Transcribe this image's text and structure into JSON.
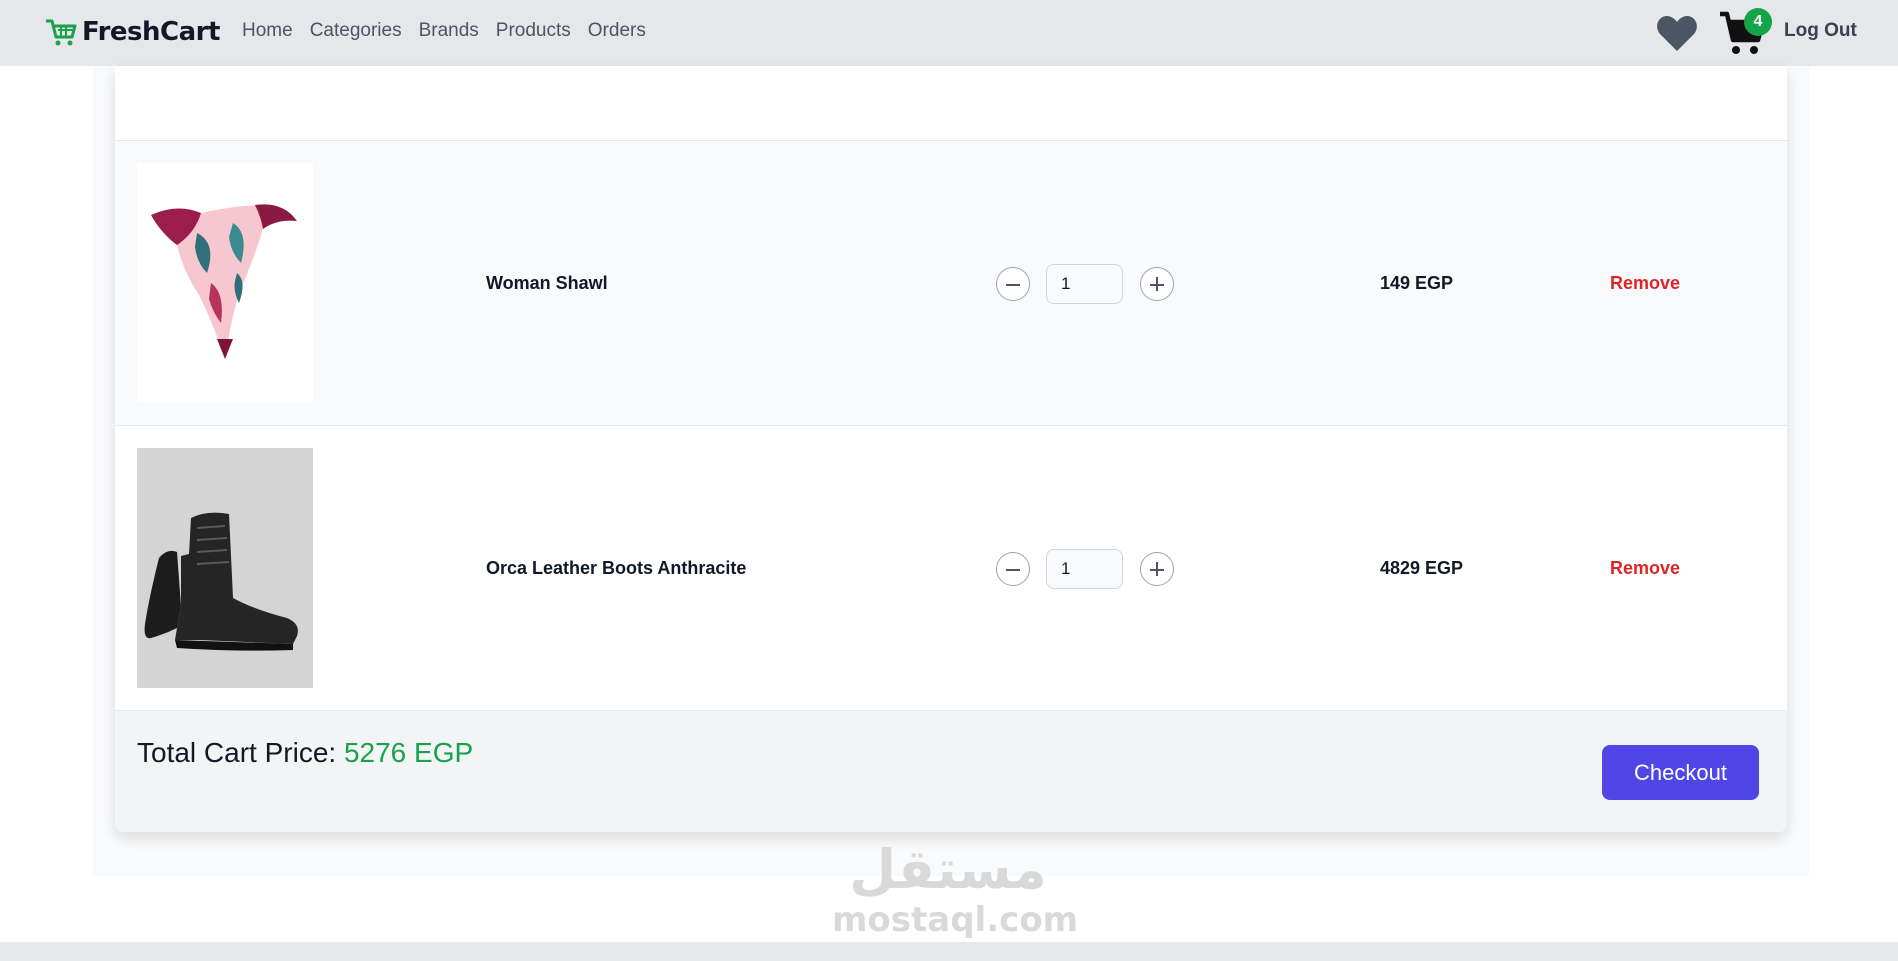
{
  "navbar": {
    "brand": "FreshCart",
    "links": [
      "Home",
      "Categories",
      "Brands",
      "Products",
      "Orders"
    ],
    "cart_count": "4",
    "logout": "Log Out"
  },
  "cart": {
    "items": [
      {
        "name": "Woman Shawl",
        "quantity": "1",
        "price": "149 EGP",
        "remove": "Remove"
      },
      {
        "name": "Orca Leather Boots Anthracite",
        "quantity": "1",
        "price": "4829 EGP",
        "remove": "Remove"
      }
    ],
    "total_label": "Total Cart Price:",
    "total_value": "5276 EGP",
    "checkout": "Checkout"
  },
  "watermark": {
    "arabic": "مستقل",
    "latin": "mostaql.com"
  },
  "colors": {
    "brand_green": "#16a34a",
    "remove_red": "#dc2626",
    "checkout_indigo": "#4f46e5",
    "navbar_bg": "#e5e7eb"
  }
}
